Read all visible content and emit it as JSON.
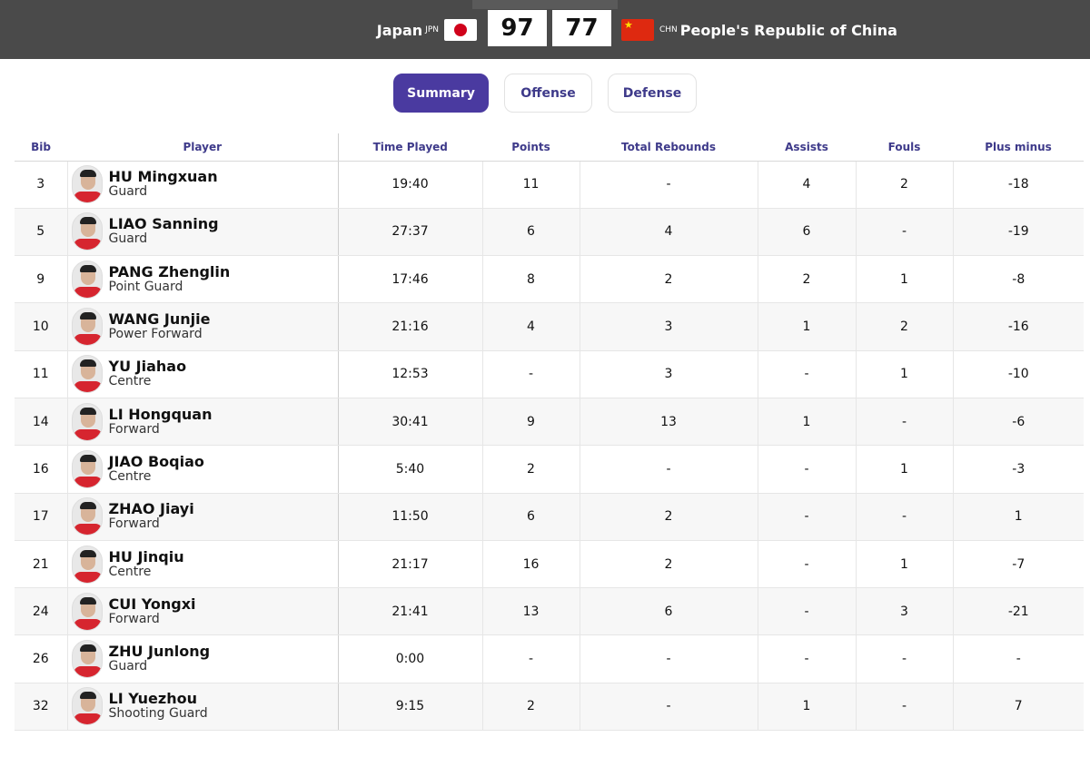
{
  "header": {
    "home": {
      "name": "Japan",
      "code": "JPN",
      "score": "97",
      "flag_icon": "japan-flag-icon"
    },
    "away": {
      "name": "People's Republic of China",
      "code": "CHN",
      "score": "77",
      "flag_icon": "china-flag-icon"
    }
  },
  "tabs": [
    {
      "label": "Summary",
      "active": true
    },
    {
      "label": "Offense",
      "active": false
    },
    {
      "label": "Defense",
      "active": false
    }
  ],
  "table": {
    "headers": [
      "Bib",
      "Player",
      "Time Played",
      "Points",
      "Total Rebounds",
      "Assists",
      "Fouls",
      "Plus minus"
    ],
    "rows": [
      {
        "bib": "3",
        "name": "HU Mingxuan",
        "position": "Guard",
        "time": "19:40",
        "points": "11",
        "rebounds": "-",
        "assists": "4",
        "fouls": "2",
        "plusminus": "-18"
      },
      {
        "bib": "5",
        "name": "LIAO Sanning",
        "position": "Guard",
        "time": "27:37",
        "points": "6",
        "rebounds": "4",
        "assists": "6",
        "fouls": "-",
        "plusminus": "-19"
      },
      {
        "bib": "9",
        "name": "PANG Zhenglin",
        "position": "Point Guard",
        "time": "17:46",
        "points": "8",
        "rebounds": "2",
        "assists": "2",
        "fouls": "1",
        "plusminus": "-8"
      },
      {
        "bib": "10",
        "name": "WANG Junjie",
        "position": "Power Forward",
        "time": "21:16",
        "points": "4",
        "rebounds": "3",
        "assists": "1",
        "fouls": "2",
        "plusminus": "-16"
      },
      {
        "bib": "11",
        "name": "YU Jiahao",
        "position": "Centre",
        "time": "12:53",
        "points": "-",
        "rebounds": "3",
        "assists": "-",
        "fouls": "1",
        "plusminus": "-10"
      },
      {
        "bib": "14",
        "name": "LI Hongquan",
        "position": "Forward",
        "time": "30:41",
        "points": "9",
        "rebounds": "13",
        "assists": "1",
        "fouls": "-",
        "plusminus": "-6"
      },
      {
        "bib": "16",
        "name": "JIAO Boqiao",
        "position": "Centre",
        "time": "5:40",
        "points": "2",
        "rebounds": "-",
        "assists": "-",
        "fouls": "1",
        "plusminus": "-3"
      },
      {
        "bib": "17",
        "name": "ZHAO Jiayi",
        "position": "Forward",
        "time": "11:50",
        "points": "6",
        "rebounds": "2",
        "assists": "-",
        "fouls": "-",
        "plusminus": "1"
      },
      {
        "bib": "21",
        "name": "HU Jinqiu",
        "position": "Centre",
        "time": "21:17",
        "points": "16",
        "rebounds": "2",
        "assists": "-",
        "fouls": "1",
        "plusminus": "-7"
      },
      {
        "bib": "24",
        "name": "CUI Yongxi",
        "position": "Forward",
        "time": "21:41",
        "points": "13",
        "rebounds": "6",
        "assists": "-",
        "fouls": "3",
        "plusminus": "-21"
      },
      {
        "bib": "26",
        "name": "ZHU Junlong",
        "position": "Guard",
        "time": "0:00",
        "points": "-",
        "rebounds": "-",
        "assists": "-",
        "fouls": "-",
        "plusminus": "-"
      },
      {
        "bib": "32",
        "name": "LI Yuezhou",
        "position": "Shooting Guard",
        "time": "9:15",
        "points": "2",
        "rebounds": "-",
        "assists": "1",
        "fouls": "-",
        "plusminus": "7"
      }
    ]
  }
}
